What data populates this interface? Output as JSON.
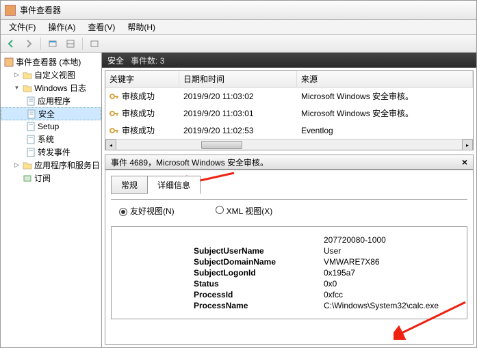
{
  "window": {
    "title": "事件查看器"
  },
  "menu": {
    "file": "文件(F)",
    "action": "操作(A)",
    "view": "查看(V)",
    "help": "帮助(H)"
  },
  "tree": {
    "root": "事件查看器 (本地)",
    "custom": "自定义视图",
    "winlogs": "Windows 日志",
    "app": "应用程序",
    "security": "安全",
    "setup": "Setup",
    "system": "系统",
    "forward": "转发事件",
    "appserv": "应用程序和服务日",
    "subs": "订阅"
  },
  "hdr": {
    "title": "安全",
    "count_label": "事件数:",
    "count": "3"
  },
  "cols": {
    "kw": "关键字",
    "dt": "日期和时间",
    "src": "来源"
  },
  "rows": [
    {
      "kw": "审核成功",
      "dt": "2019/9/20 11:03:02",
      "src": "Microsoft Windows 安全审核。"
    },
    {
      "kw": "审核成功",
      "dt": "2019/9/20 11:03:01",
      "src": "Microsoft Windows 安全审核。"
    },
    {
      "kw": "审核成功",
      "dt": "2019/9/20 11:02:53",
      "src": "Eventlog"
    }
  ],
  "detail": {
    "title": "事件 4689，Microsoft Windows 安全审核。"
  },
  "tabs": {
    "general": "常规",
    "details": "详细信息"
  },
  "radios": {
    "friendly": "友好视图(N)",
    "xml": "XML 视图(X)"
  },
  "kv": {
    "topval": "207720080-1000",
    "k1": "SubjectUserName",
    "v1": "User",
    "k2": "SubjectDomainName",
    "v2": "VMWARE7X86",
    "k3": "SubjectLogonId",
    "v3": "0x195a7",
    "k4": "Status",
    "v4": "0x0",
    "k5": "ProcessId",
    "v5": "0xfcc",
    "k6": "ProcessName",
    "v6": "C:\\Windows\\System32\\calc.exe"
  }
}
